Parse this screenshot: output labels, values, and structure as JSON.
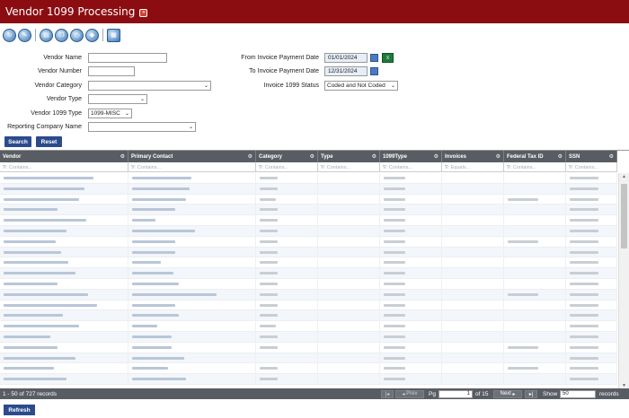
{
  "app": {
    "title": "Vendor 1099 Processing",
    "title_go_icon": "arrow-right-icon"
  },
  "toolbar": {
    "icons": [
      "refresh-icon",
      "edit-icon",
      "print-icon",
      "copy-icon",
      "history-icon",
      "tag-icon",
      "export-icon"
    ]
  },
  "form": {
    "vendor_name": {
      "label": "Vendor Name",
      "value": ""
    },
    "vendor_number": {
      "label": "Vendor Number",
      "value": ""
    },
    "vendor_category": {
      "label": "Vendor Category",
      "value": ""
    },
    "vendor_type": {
      "label": "Vendor Type",
      "value": ""
    },
    "vendor_1099_type": {
      "label": "Vendor 1099 Type",
      "value": "1099-MISC"
    },
    "reporting_company": {
      "label": "Reporting Company Name",
      "value": ""
    },
    "from_date": {
      "label": "From Invoice Payment Date",
      "value": "01/01/2024"
    },
    "to_date": {
      "label": "To Invoice Payment Date",
      "value": "12/31/2024"
    },
    "status": {
      "label": "Invoice 1099 Status",
      "value": "Coded and Not Coded"
    },
    "search_label": "Search",
    "reset_label": "Reset"
  },
  "grid": {
    "columns": [
      {
        "label": "Vendor",
        "filter": "Contains..."
      },
      {
        "label": "Primary Contact",
        "filter": "Contains..."
      },
      {
        "label": "Category",
        "filter": "Contains..."
      },
      {
        "label": "Type",
        "filter": "Contains..."
      },
      {
        "label": "1099Type",
        "filter": "Contains..."
      },
      {
        "label": "Invoices",
        "filter": "Equals..."
      },
      {
        "label": "Federal Tax ID",
        "filter": "Contains..."
      },
      {
        "label": "SSN",
        "filter": "Contains..."
      }
    ],
    "row_count_visible": 20
  },
  "pager": {
    "records_text": "1 - 50 of 727 records",
    "prev_label": "Prev",
    "pg_label": "Pg",
    "page_value": "1",
    "of_label": "of 15",
    "next_label": "Next",
    "show_label": "Show",
    "show_value": "50",
    "records_label": "records"
  },
  "footer": {
    "refresh_label": "Refresh"
  }
}
